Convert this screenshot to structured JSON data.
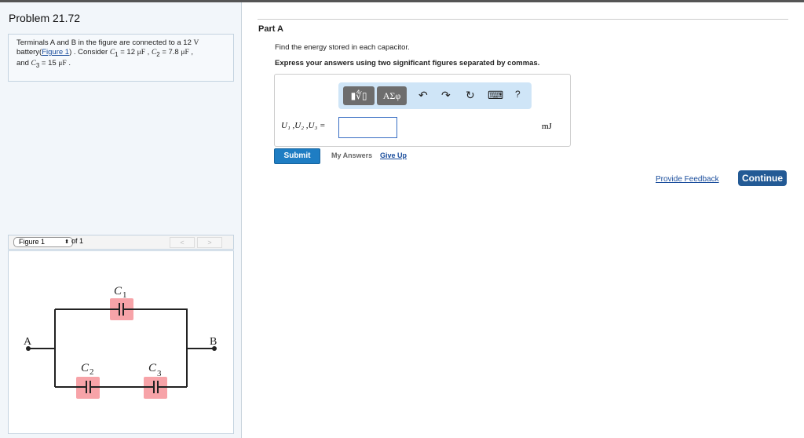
{
  "problem": {
    "title": "Problem 21.72",
    "text1": "Terminals A and B in the figure are connected to a 12 ",
    "volt": "V",
    "text2": "battery(",
    "figure_link": "Figure 1",
    "text3": ") . Consider ",
    "c1": "C",
    "c1sub": "1",
    "c1val": " = 12 ",
    "uF": "μF",
    "c2": "C",
    "c2sub": "2",
    "c2val": " = 7.8 ",
    "text4": "and ",
    "c3": "C",
    "c3sub": "3",
    "c3val": " = 15 "
  },
  "figure": {
    "selector": "Figure 1",
    "of": "of 1",
    "prev": "<",
    "next": ">",
    "labels": {
      "A": "A",
      "B": "B",
      "C": "C",
      "s1": "1",
      "s2": "2",
      "s3": "3"
    }
  },
  "part": {
    "title": "Part A",
    "question": "Find the energy stored in each capacitor.",
    "instructions": "Express your answers using two significant figures separated by commas.",
    "templates_btn": "▮∜▯",
    "symbols_btn": "ΑΣφ",
    "undo": "↶",
    "redo": "↷",
    "reset": "↻",
    "keyboard": "⌨",
    "help": "?",
    "label": "U₁ ,U₂ ,U₃ =",
    "input_value": "",
    "unit": "mJ",
    "submit": "Submit",
    "my_answers": "My Answers",
    "give_up": "Give Up"
  },
  "footer": {
    "feedback": "Provide Feedback",
    "continue": "Continue"
  }
}
